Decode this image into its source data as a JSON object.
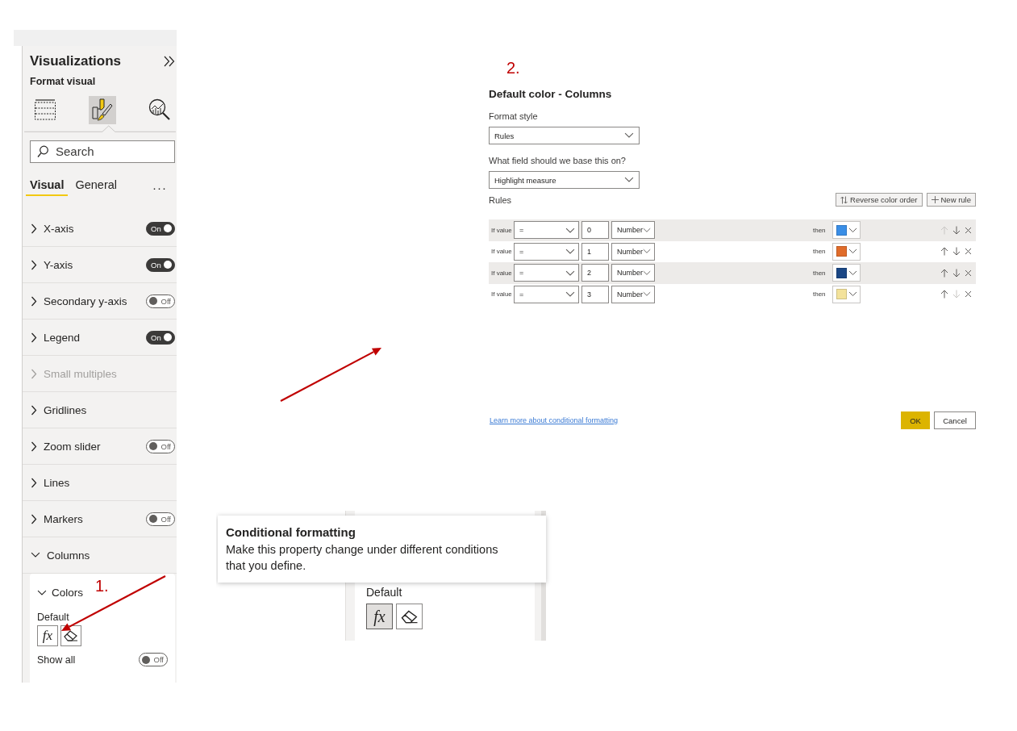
{
  "panel": {
    "title": "Visualizations",
    "subtitle": "Format visual",
    "view_buttons": [
      {
        "kind": "build",
        "selected": false
      },
      {
        "kind": "format",
        "selected": true
      },
      {
        "kind": "analytics",
        "selected": false
      }
    ],
    "search": {
      "placeholder": "Search"
    },
    "tabs": [
      {
        "label": "Visual",
        "selected": true
      },
      {
        "label": "General",
        "selected": false
      }
    ],
    "more": "···",
    "sections": [
      {
        "label": "X-axis",
        "expanded": false,
        "disabled": false,
        "toggle": {
          "on": true,
          "text": "On"
        }
      },
      {
        "label": "Y-axis",
        "expanded": false,
        "disabled": false,
        "toggle": {
          "on": true,
          "text": "On"
        }
      },
      {
        "label": "Secondary y-axis",
        "expanded": false,
        "disabled": false,
        "toggle": {
          "on": false,
          "text": "Off"
        }
      },
      {
        "label": "Legend",
        "expanded": false,
        "disabled": false,
        "toggle": {
          "on": true,
          "text": "On"
        }
      },
      {
        "label": "Small multiples",
        "expanded": false,
        "disabled": true
      },
      {
        "label": "Gridlines",
        "expanded": false,
        "disabled": false
      },
      {
        "label": "Zoom slider",
        "expanded": false,
        "disabled": false,
        "toggle": {
          "on": false,
          "text": "Off"
        }
      },
      {
        "label": "Lines",
        "expanded": false,
        "disabled": false
      },
      {
        "label": "Markers",
        "expanded": false,
        "disabled": false,
        "toggle": {
          "on": false,
          "text": "Off"
        }
      },
      {
        "label": "Columns",
        "expanded": true,
        "disabled": false
      }
    ],
    "card": {
      "title": "Colors",
      "expanded": true,
      "field_label": "Default",
      "fx": "fx",
      "fx_selected": false,
      "show_all": {
        "label": "Show all",
        "toggle": {
          "on": false,
          "text": "Off"
        }
      }
    }
  },
  "annotations": [
    "1.",
    "2."
  ],
  "dialog": {
    "title": "Default color - Columns",
    "fields": [
      {
        "label": "Format style",
        "value": "Rules"
      },
      {
        "label": "What field should we base this on?",
        "value": "Highlight measure"
      }
    ],
    "rules_label": "Rules",
    "actions": [
      {
        "kind": "reverse",
        "label": "Reverse color order"
      },
      {
        "kind": "add",
        "label": "New rule"
      }
    ],
    "rules": [
      {
        "prefix": "If value",
        "operator": "=",
        "value": "0",
        "unit": "Number",
        "then": "then",
        "color": "#3a8ee6",
        "shaded": true,
        "up_disabled": true,
        "down_disabled": false
      },
      {
        "prefix": "If value",
        "operator": "=",
        "value": "1",
        "unit": "Number",
        "then": "then",
        "color": "#e06c2a",
        "shaded": false,
        "up_disabled": false,
        "down_disabled": false
      },
      {
        "prefix": "If value",
        "operator": "=",
        "value": "2",
        "unit": "Number",
        "then": "then",
        "color": "#1b4785",
        "shaded": true,
        "up_disabled": false,
        "down_disabled": false
      },
      {
        "prefix": "If value",
        "operator": "=",
        "value": "3",
        "unit": "Number",
        "then": "then",
        "color": "#f3e29b",
        "shaded": false,
        "up_disabled": false,
        "down_disabled": true
      }
    ],
    "link": "Learn more about conditional formatting",
    "buttons": [
      {
        "label": "OK",
        "primary": true
      },
      {
        "label": "Cancel",
        "primary": false
      }
    ]
  },
  "inset": {
    "tooltip": {
      "title": "Conditional formatting",
      "text": "Make this property change under different conditions that you define."
    },
    "field_label": "Default",
    "fx": "fx",
    "fx_selected": true
  }
}
